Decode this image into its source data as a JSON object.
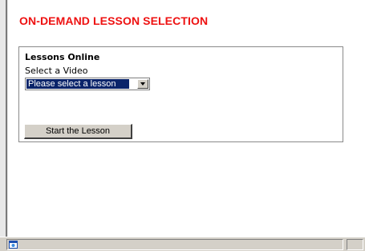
{
  "page": {
    "title": "ON-DEMAND LESSON SELECTION",
    "title_color": "#ee1111"
  },
  "lessons_panel": {
    "heading": "Lessons Online",
    "select_label": "Select a Video",
    "select_value": "Please select a lesson",
    "start_button_label": "Start the Lesson"
  },
  "status_bar": {
    "icon": "ie-page-icon"
  },
  "colors": {
    "selection_highlight": "#0a246a",
    "button_face": "#d4d0c8"
  }
}
